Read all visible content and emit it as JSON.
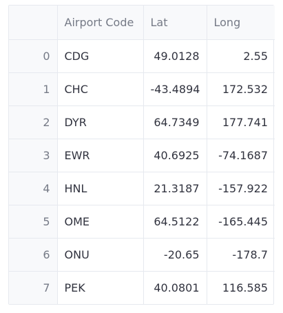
{
  "table": {
    "columns": [
      "",
      "Airport Code",
      "Lat",
      "Long"
    ],
    "rows": [
      {
        "index": "0",
        "code": "CDG",
        "lat": "49.0128",
        "long": "2.55"
      },
      {
        "index": "1",
        "code": "CHC",
        "lat": "-43.4894",
        "long": "172.532"
      },
      {
        "index": "2",
        "code": "DYR",
        "lat": "64.7349",
        "long": "177.741"
      },
      {
        "index": "3",
        "code": "EWR",
        "lat": "40.6925",
        "long": "-74.1687"
      },
      {
        "index": "4",
        "code": "HNL",
        "lat": "21.3187",
        "long": "-157.922"
      },
      {
        "index": "5",
        "code": "OME",
        "lat": "64.5122",
        "long": "-165.445"
      },
      {
        "index": "6",
        "code": "ONU",
        "lat": "-20.65",
        "long": "-178.7"
      },
      {
        "index": "7",
        "code": "PEK",
        "lat": "40.0801",
        "long": "116.585"
      }
    ]
  }
}
